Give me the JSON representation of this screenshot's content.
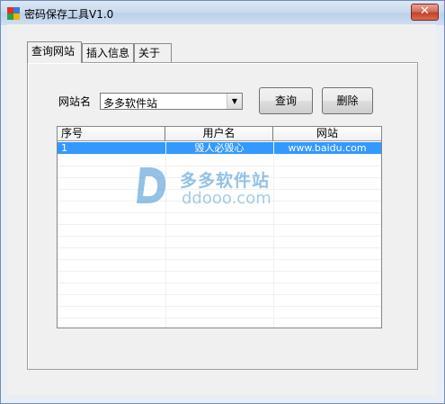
{
  "window": {
    "title": "密码保存工具V1.0",
    "close_glyph": "✕"
  },
  "tabs": [
    {
      "label": "查询网站",
      "active": true
    },
    {
      "label": "插入信息",
      "active": false
    },
    {
      "label": "关于",
      "active": false
    }
  ],
  "query_panel": {
    "site_label": "网站名",
    "site_select_value": "多多软件站",
    "query_button": "查询",
    "delete_button": "删除"
  },
  "table": {
    "columns": [
      "序号",
      "用户名",
      "网站"
    ],
    "rows": [
      {
        "index": "1",
        "username": "毁人必毁心",
        "site": "www.baidu.com",
        "selected": true
      }
    ]
  },
  "watermark": {
    "cn": "多多软件站",
    "en": "ddooo.com"
  },
  "colors": {
    "selection": "#3399ff",
    "watermark": "#3d8fd1"
  }
}
